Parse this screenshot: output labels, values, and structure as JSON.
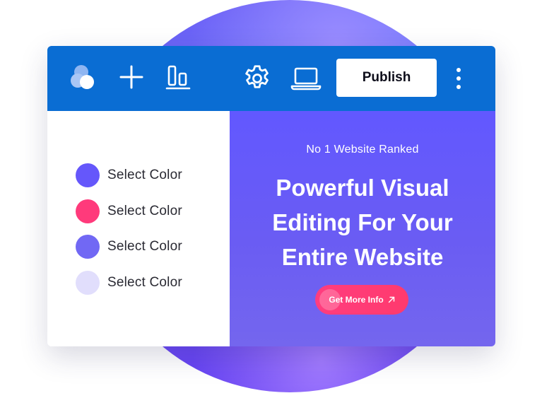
{
  "toolbar": {
    "icons": [
      "logo-icon",
      "plus-icon",
      "align-bottom-icon",
      "gear-icon",
      "laptop-icon",
      "more-vertical-icon"
    ],
    "publish_label": "Publish",
    "background": "#0a6dd3"
  },
  "color_panel": {
    "items": [
      {
        "label": "Select Color",
        "color": "#6557fb"
      },
      {
        "label": "Select Color",
        "color": "#ff3a7b"
      },
      {
        "label": "Select Color",
        "color": "#7168f4"
      },
      {
        "label": "Select Color",
        "color": "#e1defc"
      }
    ]
  },
  "preview": {
    "kicker": "No 1 Website Ranked",
    "headline_lines": [
      "Powerful Visual",
      "Editing For Your",
      "Entire Website"
    ],
    "cta_label": "Get More Info",
    "cta_icon": "arrow-up-right-icon",
    "cta_color": "#ff3d7f",
    "background": "#6258ff"
  }
}
